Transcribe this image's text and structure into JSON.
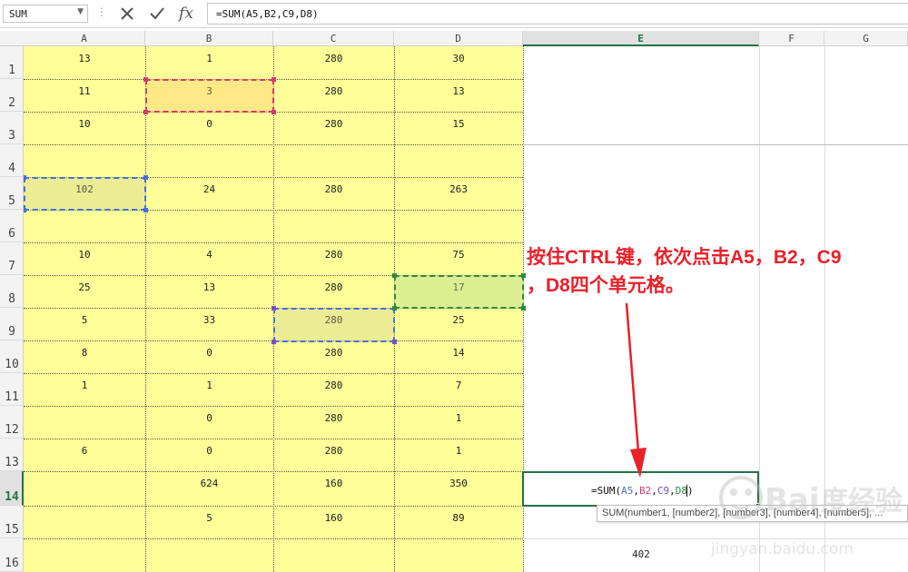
{
  "formula_bar": {
    "name_box": "SUM",
    "formula": "=SUM(A5,B2,C9,D8)",
    "cancel_icon": "close-icon",
    "enter_icon": "check-icon",
    "fx_label": "fx"
  },
  "columns": [
    "A",
    "B",
    "C",
    "D",
    "E",
    "F",
    "G"
  ],
  "active_column": "E",
  "rows": [
    "1",
    "2",
    "3",
    "4",
    "5",
    "6",
    "7",
    "8",
    "9",
    "10",
    "11",
    "12",
    "13",
    "14",
    "15",
    "16"
  ],
  "active_row": "14",
  "cells": [
    [
      "13",
      "1",
      "280",
      "30"
    ],
    [
      "11",
      "3",
      "280",
      "13"
    ],
    [
      "10",
      "0",
      "280",
      "15"
    ],
    [
      "",
      "",
      "",
      ""
    ],
    [
      "102",
      "24",
      "280",
      "263"
    ],
    [
      "",
      "",
      "",
      ""
    ],
    [
      "10",
      "4",
      "280",
      "75"
    ],
    [
      "25",
      "13",
      "280",
      "17"
    ],
    [
      "5",
      "33",
      "280",
      "25"
    ],
    [
      "8",
      "0",
      "280",
      "14"
    ],
    [
      "1",
      "1",
      "280",
      "7"
    ],
    [
      "",
      "0",
      "280",
      "1"
    ],
    [
      "6",
      "0",
      "280",
      "1"
    ],
    [
      "",
      "624",
      "160",
      "350"
    ],
    [
      "",
      "5",
      "160",
      "89"
    ],
    [
      "",
      "",
      "",
      ""
    ]
  ],
  "editing_cell": {
    "reference": "E14",
    "formula_parts": [
      {
        "text": "=SUM(",
        "color": "#111111"
      },
      {
        "text": "A5",
        "color": "#4a6fd6"
      },
      {
        "text": ",",
        "color": "#111111"
      },
      {
        "text": "B2",
        "color": "#d43a6e"
      },
      {
        "text": ",",
        "color": "#111111"
      },
      {
        "text": "C9",
        "color": "#7a4fc4"
      },
      {
        "text": ",",
        "color": "#111111"
      },
      {
        "text": "D8",
        "color": "#2e8b3e"
      },
      {
        "text": ")",
        "color": "#111111"
      }
    ]
  },
  "e16_value": "402",
  "tooltip": "SUM(number1, [number2], [number3], [number4], [number5], ...",
  "annotation": {
    "line1": "按住CTRL键，依次点击A5，B2，C9",
    "line2": "，D8四个单元格。"
  },
  "watermark": {
    "brand": "Bai度经验",
    "url": "jingyan.baidu.com"
  },
  "colors": {
    "cell_fill": "#ffff99",
    "active_green": "#217346",
    "annotation_red": "#e8212a",
    "ref_A5": "#4a6fd6",
    "ref_B2": "#d43a6e",
    "ref_C9": "#7a4fc4",
    "ref_D8": "#2e8b3e"
  }
}
